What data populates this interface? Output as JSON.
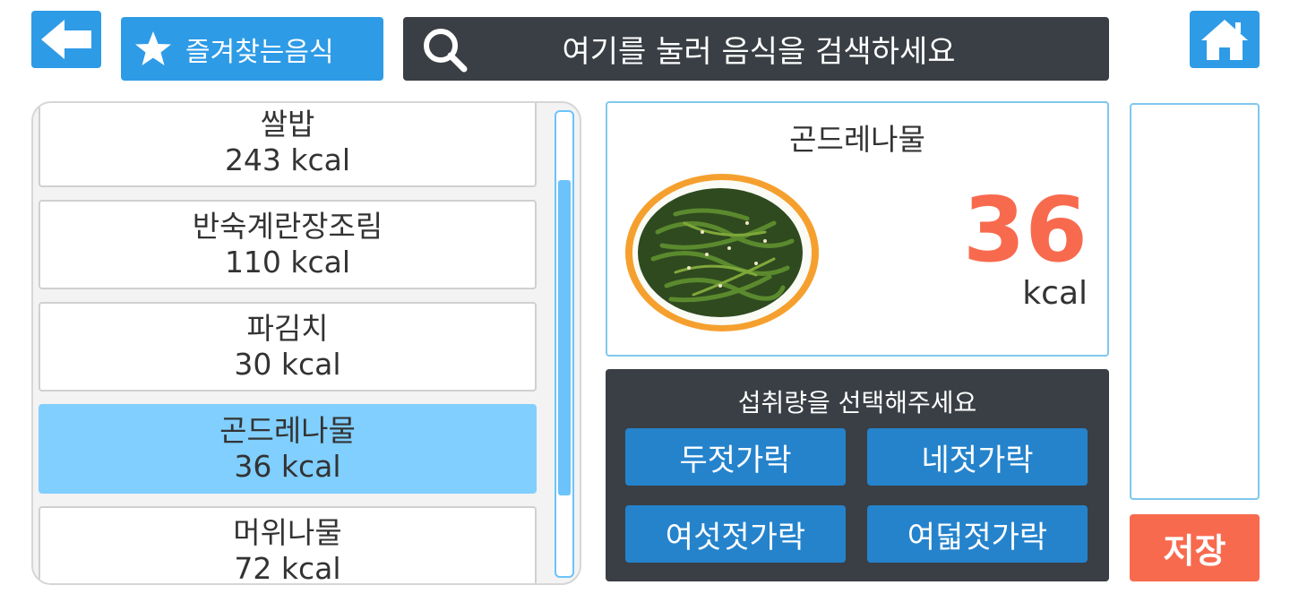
{
  "header": {
    "back_icon": "arrow-left-icon",
    "favorites_label": "즐겨찾는음식",
    "search_placeholder": "여기를 눌러 음식을 검색하세요",
    "home_icon": "home-icon"
  },
  "food_list": {
    "items": [
      {
        "name": "쌀밥",
        "kcal": "243 kcal",
        "selected": false
      },
      {
        "name": "반숙계란장조림",
        "kcal": "110 kcal",
        "selected": false
      },
      {
        "name": "파김치",
        "kcal": "30 kcal",
        "selected": false
      },
      {
        "name": "곤드레나물",
        "kcal": "36 kcal",
        "selected": true
      },
      {
        "name": "머위나물",
        "kcal": "72 kcal",
        "selected": false
      }
    ]
  },
  "detail": {
    "name": "곤드레나물",
    "kcal_value": "36",
    "kcal_unit": "kcal"
  },
  "portion": {
    "prompt": "섭취량을 선택해주세요",
    "options": [
      "두젓가락",
      "네젓가락",
      "여섯젓가락",
      "여덟젓가락"
    ]
  },
  "save_label": "저장",
  "colors": {
    "accent_blue": "#2e9be6",
    "selected_row": "#80cfff",
    "dark_panel": "#3a3f45",
    "kcal_orange": "#f86a4e",
    "portion_button": "#2583cc"
  }
}
